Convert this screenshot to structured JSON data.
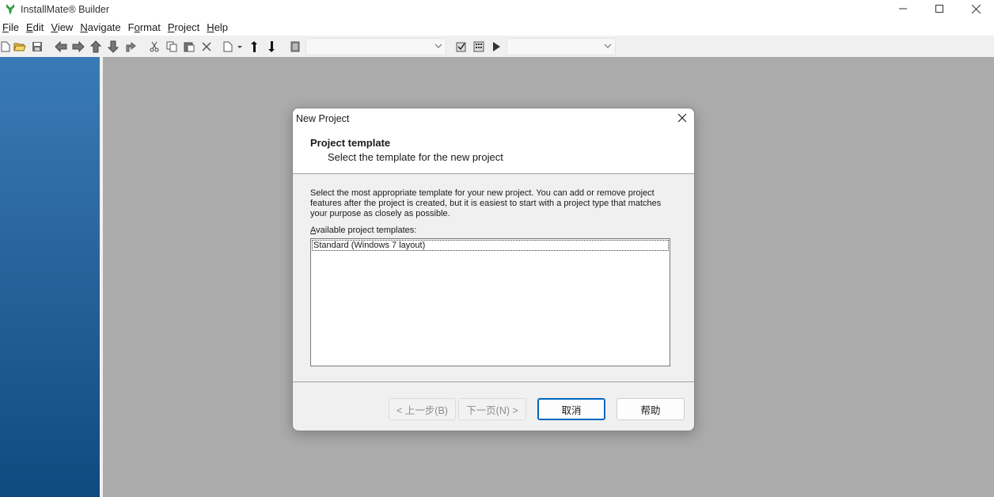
{
  "window": {
    "title": "InstallMate® Builder"
  },
  "menu": [
    {
      "pre": "",
      "u": "F",
      "post": "ile"
    },
    {
      "pre": "",
      "u": "E",
      "post": "dit"
    },
    {
      "pre": "",
      "u": "V",
      "post": "iew"
    },
    {
      "pre": "",
      "u": "N",
      "post": "avigate"
    },
    {
      "pre": "F",
      "u": "o",
      "post": "rmat"
    },
    {
      "pre": "",
      "u": "P",
      "post": "roject"
    },
    {
      "pre": "",
      "u": "H",
      "post": "elp"
    }
  ],
  "toolbar": {
    "combo1_value": "",
    "combo2_value": "",
    "icons": [
      "new-icon",
      "open-icon",
      "save-icon",
      "back-icon",
      "forward-icon",
      "up-icon",
      "down-icon",
      "jump-icon",
      "cut-icon",
      "copy-icon",
      "paste-icon",
      "delete-icon",
      "new-item-icon",
      "move-up-icon",
      "move-down-icon",
      "build-config-icon",
      "check-icon",
      "calculator-icon",
      "run-icon"
    ]
  },
  "dialog": {
    "title": "New Project",
    "header_title": "Project template",
    "header_subtitle": "Select the template for the new project",
    "description": "Select the most appropriate template for your new project. You can add or remove project features after the project is created, but it is easiest to start with a project type that matches your purpose as closely as possible.",
    "list_label_u": "A",
    "list_label_rest": "vailable project templates:",
    "templates": [
      "Standard (Windows 7 layout)"
    ],
    "buttons": {
      "back": "< 上一步(B)",
      "next": "下一页(N) >",
      "cancel": "取消",
      "help": "帮助"
    }
  },
  "colors": {
    "accent": "#0067c0",
    "workarea": "#ababab",
    "panel_top": "#3a7bb5",
    "panel_bottom": "#0f4a7f",
    "app_icon": "#2e9a3a"
  }
}
